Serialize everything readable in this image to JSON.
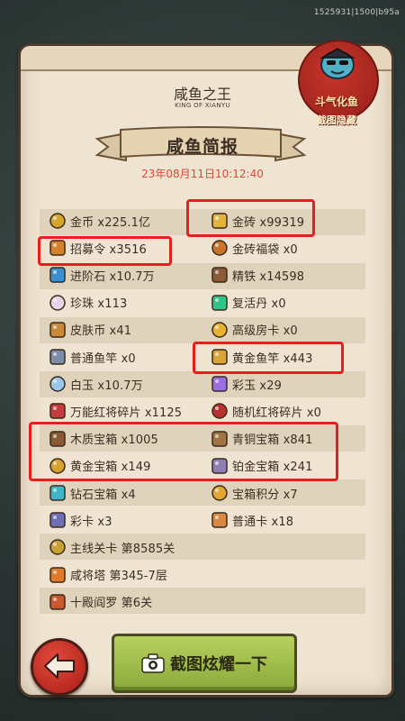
{
  "header": {
    "id_text": "1525931|1500|b95a",
    "title": "咸鱼之王",
    "subtitle": "KING OF XIANYU",
    "banner": "咸鱼简报",
    "date": "23年08月11日10:12:40"
  },
  "stamp": {
    "line1": "斗气化鱼",
    "line2": "截图隐藏"
  },
  "items": [
    {
      "label": "金币 x225.1亿",
      "icon": "gold-coin-icon",
      "color": "#d4a72c"
    },
    {
      "label": "金砖 x99319",
      "icon": "gold-brick-icon",
      "color": "#e2b53a"
    },
    {
      "label": "招募令 x3516",
      "icon": "recruit-order-icon",
      "color": "#d5832a"
    },
    {
      "label": "金砖福袋 x0",
      "icon": "gold-lucky-bag-icon",
      "color": "#c9762a"
    },
    {
      "label": "进阶石 x10.7万",
      "icon": "advance-stone-icon",
      "color": "#3c8fd0"
    },
    {
      "label": "精铁 x14598",
      "icon": "refined-iron-icon",
      "color": "#8a5a3a"
    },
    {
      "label": "珍珠 x113",
      "icon": "pearl-icon",
      "color": "#e9d3e6"
    },
    {
      "label": "复活丹 x0",
      "icon": "revive-pill-icon",
      "color": "#2fc58a"
    },
    {
      "label": "皮肤币 x41",
      "icon": "skin-coin-icon",
      "color": "#c98a3a"
    },
    {
      "label": "高级房卡 x0",
      "icon": "premium-room-card-icon",
      "color": "#e8b22e"
    },
    {
      "label": "普通鱼竿 x0",
      "icon": "normal-rod-icon",
      "color": "#7d8da8"
    },
    {
      "label": "黄金鱼竿 x443",
      "icon": "golden-rod-icon",
      "color": "#d9a636"
    },
    {
      "label": "白玉 x10.7万",
      "icon": "white-jade-icon",
      "color": "#9cc7e6"
    },
    {
      "label": "彩玉 x29",
      "icon": "color-jade-icon",
      "color": "#9a6ee0"
    },
    {
      "label": "万能红将碎片 x1125",
      "icon": "universal-red-fragment-icon",
      "color": "#c63b3b"
    },
    {
      "label": "随机红将碎片 x0",
      "icon": "random-red-fragment-icon",
      "color": "#b7322e"
    },
    {
      "label": "木质宝箱 x1005",
      "icon": "wooden-chest-icon",
      "color": "#8b5a32"
    },
    {
      "label": "青铜宝箱 x841",
      "icon": "bronze-chest-icon",
      "color": "#a27440"
    },
    {
      "label": "黄金宝箱 x149",
      "icon": "gold-chest-icon",
      "color": "#d5a330"
    },
    {
      "label": "铂金宝箱 x241",
      "icon": "platinum-chest-icon",
      "color": "#8c7fb5"
    },
    {
      "label": "钻石宝箱 x4",
      "icon": "diamond-chest-icon",
      "color": "#3fb7c9"
    },
    {
      "label": "宝箱积分 x7",
      "icon": "chest-points-icon",
      "color": "#e0a630"
    },
    {
      "label": "彩卡 x3",
      "icon": "color-card-icon",
      "color": "#6a6fb8"
    },
    {
      "label": "普通卡 x18",
      "icon": "normal-card-icon",
      "color": "#d98a3e"
    },
    {
      "label": "主线关卡 第8585关",
      "icon": "main-stage-icon",
      "color": "#c9a235"
    },
    {
      "label": "咸将塔 第345-7层",
      "icon": "tower-icon",
      "color": "#e07a2a"
    },
    {
      "label": "十殿阎罗 第6关",
      "icon": "hell-king-icon",
      "color": "#c8592e"
    }
  ],
  "buttons": {
    "screenshot": "截图炫耀一下",
    "back_icon": "back-arrow-icon",
    "camera_icon": "camera-icon"
  },
  "colors": {
    "highlight": "#ea1c1c",
    "date": "#d94a3a",
    "button_green": "#9bbb45",
    "stamp_red": "#b8281e"
  }
}
